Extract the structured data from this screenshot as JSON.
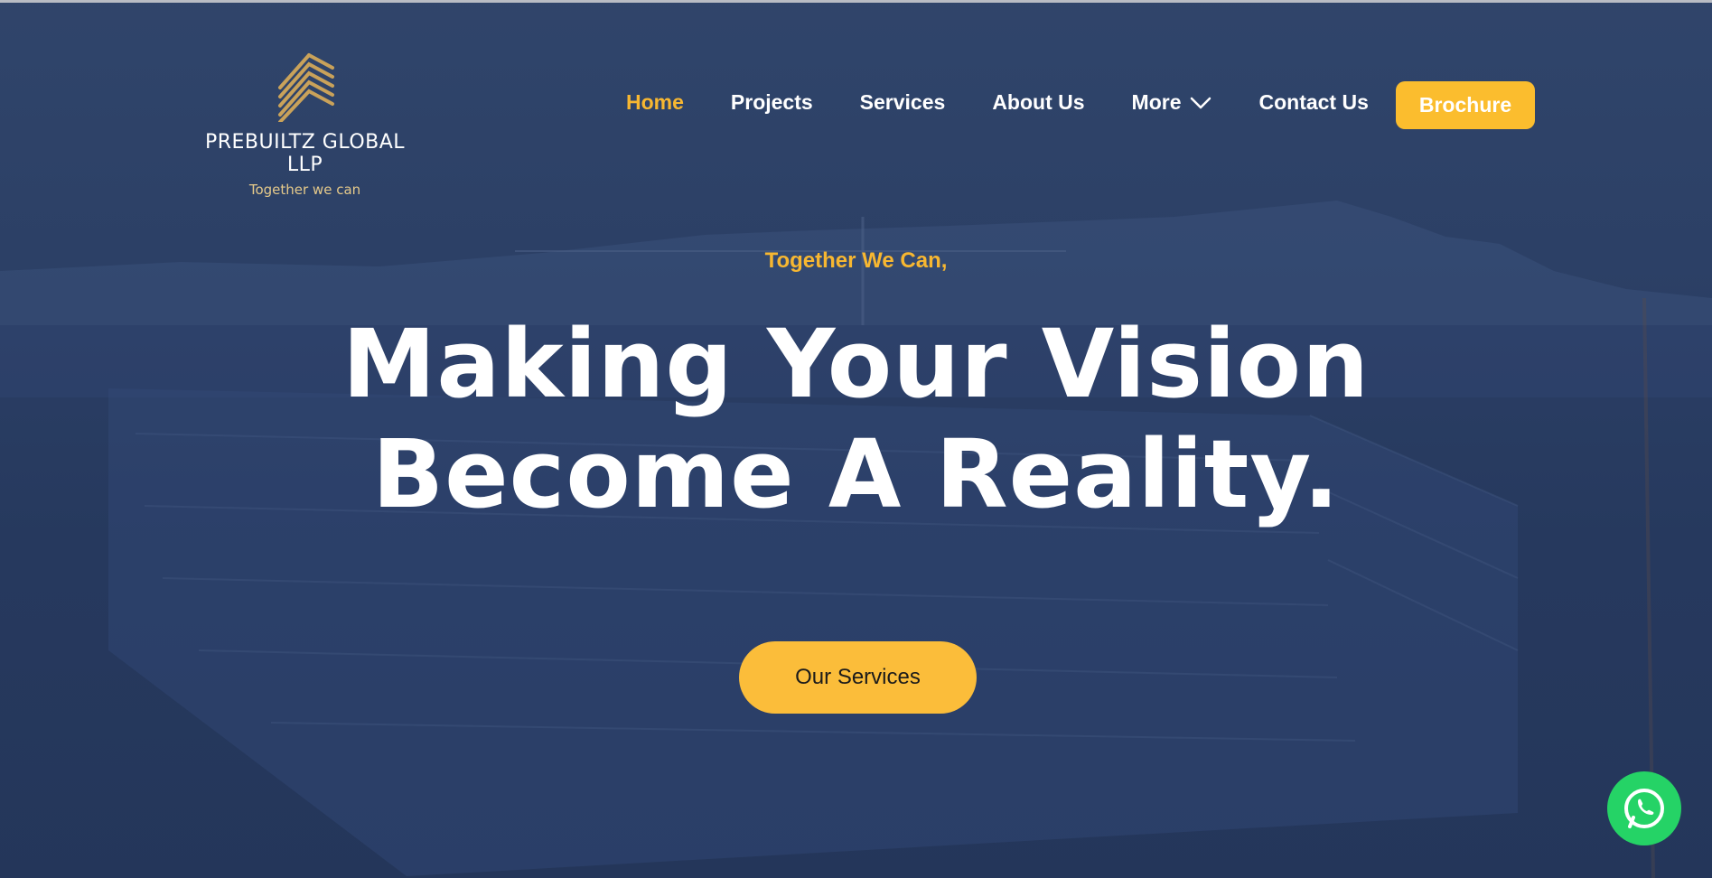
{
  "brand": {
    "name": "PREBUILTZ GLOBAL LLP",
    "tagline": "Together we can",
    "logo_icon": "stacked-roof-lines-icon",
    "accent_color": "#f7b731"
  },
  "nav": {
    "items": [
      {
        "label": "Home",
        "active": true
      },
      {
        "label": "Projects",
        "active": false
      },
      {
        "label": "Services",
        "active": false
      },
      {
        "label": "About Us",
        "active": false
      },
      {
        "label": "More",
        "active": false,
        "has_dropdown": true
      },
      {
        "label": "Contact Us",
        "active": false
      }
    ],
    "brochure_label": "Brochure"
  },
  "hero": {
    "eyebrow": "Together We Can,",
    "headline_line1": "Making Your Vision",
    "headline_line2": "Become A Reality.",
    "cta_label": "Our Services"
  },
  "floating": {
    "whatsapp_icon": "whatsapp-icon",
    "whatsapp_color": "#25d366"
  }
}
